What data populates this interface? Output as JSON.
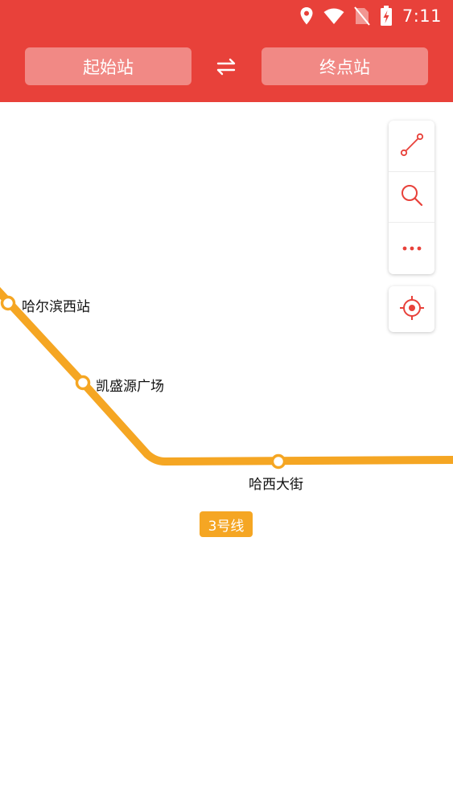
{
  "status_bar": {
    "time": "7:11",
    "icons": [
      "location-icon",
      "wifi-icon",
      "no-sim-icon",
      "battery-charging-icon"
    ]
  },
  "header": {
    "start_station_placeholder": "起始站",
    "end_station_placeholder": "终点站",
    "swap_icon": "swap-arrows-icon",
    "background_color": "#e8413a"
  },
  "map": {
    "line_color": "#f5a623",
    "line_label": "3号线",
    "stations": [
      {
        "name": "哈尔滨西站"
      },
      {
        "name": "凯盛源广场"
      },
      {
        "name": "哈西大街"
      }
    ]
  },
  "toolbar": {
    "buttons": [
      "route-icon",
      "search-icon",
      "more-icon"
    ],
    "locate_button": "locate-icon",
    "icon_color": "#e8413a"
  }
}
